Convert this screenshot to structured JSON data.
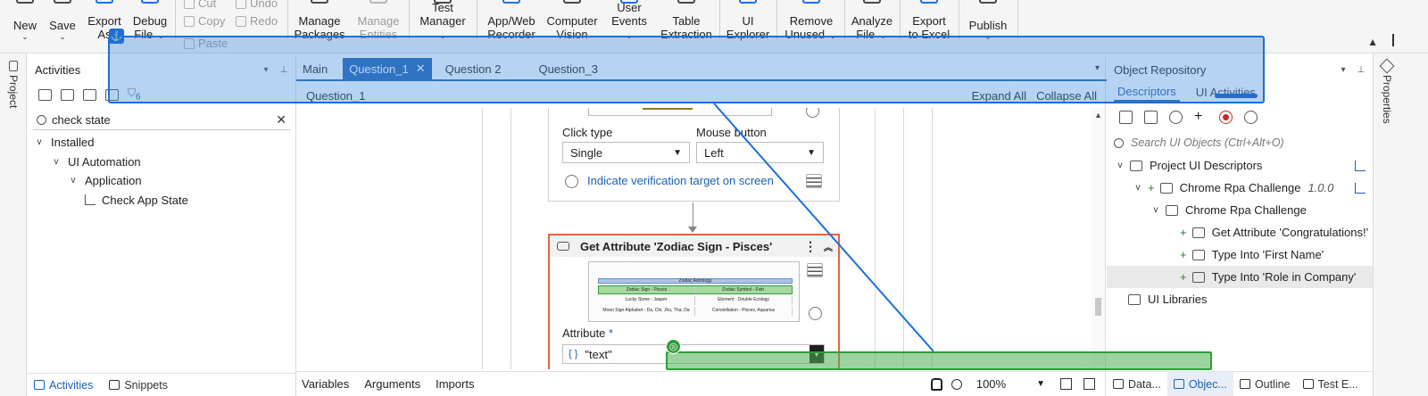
{
  "ribbon": {
    "buttons": [
      {
        "label": "New",
        "sub": "⌄"
      },
      {
        "label": "Save",
        "sub": "⌄"
      },
      {
        "label": "Export",
        "sub": "As"
      },
      {
        "label": "Debug",
        "sub": "File ⌄"
      },
      {
        "label": "Manage",
        "sub": "Packages"
      },
      {
        "label": "Manage",
        "sub": "Entities"
      },
      {
        "label": "Test",
        "sub": "Manager ⌄"
      },
      {
        "label": "App/Web",
        "sub": "Recorder"
      },
      {
        "label": "Computer",
        "sub": "Vision"
      },
      {
        "label": "User",
        "sub": "Events ⌄"
      },
      {
        "label": "Table",
        "sub": "Extraction"
      },
      {
        "label": "UI",
        "sub": "Explorer"
      },
      {
        "label": "Remove",
        "sub": "Unused ⌄"
      },
      {
        "label": "Analyze",
        "sub": "File ⌄"
      },
      {
        "label": "Export",
        "sub": "to Excel"
      },
      {
        "label": "Publish",
        "sub": "⌄"
      }
    ],
    "cut": "Cut",
    "undo": "Undo",
    "copy": "Copy",
    "redo": "Redo",
    "paste": "Paste"
  },
  "left_strip": {
    "label": "Project"
  },
  "right_strip": {
    "label": "Properties"
  },
  "activities": {
    "title": "Activities",
    "search_value": "check state",
    "filter_count": "6",
    "tree": [
      {
        "label": "Installed",
        "level": 0
      },
      {
        "label": "UI Automation",
        "level": 1
      },
      {
        "label": "Application",
        "level": 2
      },
      {
        "label": "Check App State",
        "level": 3
      }
    ],
    "footer_tabs": [
      "Activities",
      "Snippets"
    ]
  },
  "designer": {
    "tabs": [
      "Main",
      "Question_1",
      "Question 2",
      "Question_3"
    ],
    "active_tab": "Question_1",
    "breadcrumb": "Question_1",
    "expand_all": "Expand All",
    "collapse_all": "Collapse All",
    "click_card": {
      "click_type_label": "Click type",
      "click_type_value": "Single",
      "mouse_button_label": "Mouse button",
      "mouse_button_value": "Left",
      "verify_link": "Indicate verification target on screen"
    },
    "getattr_card": {
      "title": "Get Attribute 'Zodiac Sign - Pisces'",
      "table_title": "Zodiac Astrology",
      "table_rows": [
        [
          "Zodiac Sign - Pisces",
          "Zodiac Symbol - Fish"
        ],
        [
          "Lucky Stone - Jasper",
          "Element - Double Ecology"
        ],
        [
          "Moon Sign Alphabet - Da, Chi, Jhu, Tha, Da",
          "Constellation - Pisces, Aquarius"
        ]
      ],
      "attribute_label": "Attribute",
      "required_mark": "*",
      "attribute_value": "\"text\"",
      "expr_marker": "{ }"
    },
    "footer": {
      "tabs": [
        "Variables",
        "Arguments",
        "Imports"
      ],
      "zoom": "100%"
    }
  },
  "object_repository": {
    "title": "Object Repository",
    "tabs": [
      "Descriptors",
      "UI Activities"
    ],
    "search_placeholder": "Search UI Objects (Ctrl+Alt+O)",
    "tree": [
      {
        "label": "Project UI Descriptors",
        "version": ""
      },
      {
        "label": "Chrome Rpa Challenge",
        "version": "1.0.0"
      },
      {
        "label": "Chrome Rpa Challenge",
        "version": ""
      },
      {
        "label": "Get Attribute 'Congratulations!'",
        "version": ""
      },
      {
        "label": "Type Into 'First Name'",
        "version": ""
      },
      {
        "label": "Type Into 'Role in Company'",
        "version": ""
      },
      {
        "label": "UI Libraries",
        "version": ""
      }
    ],
    "footer_tabs": [
      "Data...",
      "Objec...",
      "Outline",
      "Test E..."
    ]
  },
  "colors": {
    "accent": "#1a5fb4",
    "tab_active": "#1f5fb0",
    "selected_activity_border": "#e8633f",
    "overlay_blue": "#1a6fd9",
    "overlay_green": "#2e9e3a"
  }
}
